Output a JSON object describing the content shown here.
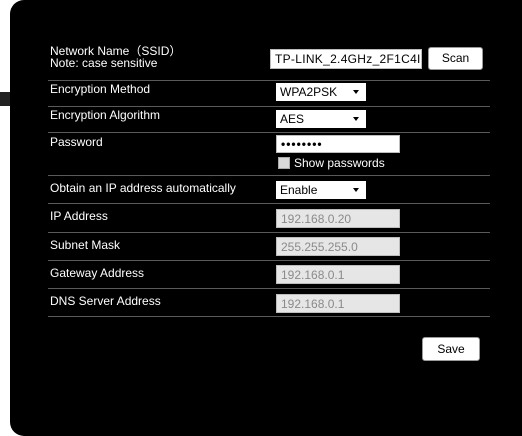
{
  "wifi": {
    "ssid_label": "Network Name（SSID）",
    "ssid_note": "Note: case sensitive",
    "ssid_value": "TP-LINK_2.4GHz_2F1C4I",
    "scan_label": "Scan",
    "encryption_method_label": "Encryption Method",
    "encryption_method_value": "WPA2PSK",
    "encryption_algorithm_label": "Encryption Algorithm",
    "encryption_algorithm_value": "AES",
    "password_label": "Password",
    "password_value": "••••••••",
    "show_passwords_label": "Show passwords"
  },
  "ip": {
    "obtain_label": "Obtain an IP address automatically",
    "obtain_value": "Enable",
    "ip_label": "IP Address",
    "ip_value": "192.168.0.20",
    "subnet_label": "Subnet Mask",
    "subnet_value": "255.255.255.0",
    "gateway_label": "Gateway Address",
    "gateway_value": "192.168.0.1",
    "dns_label": "DNS Server Address",
    "dns_value": "192.168.0.1"
  },
  "actions": {
    "save_label": "Save"
  },
  "colors": {
    "panel": "#000000",
    "divider": "#5a5a5a",
    "readonly_bg": "#e6e6e6"
  }
}
